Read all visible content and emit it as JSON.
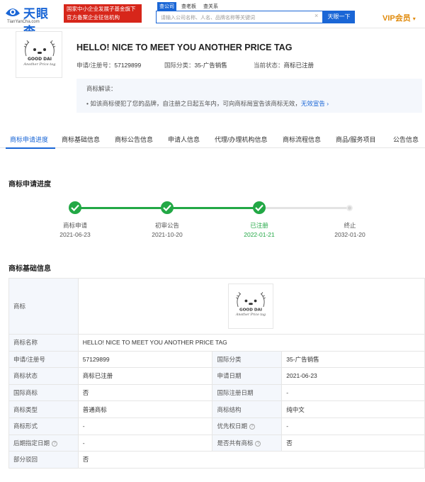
{
  "topbar": {
    "logo_text": "天眼查",
    "logo_sub": "TianYanCha.com",
    "badge_line1": "国家中小企业发展子基金旗下",
    "badge_line2": "官方备案企业征信机构",
    "search_tabs": [
      "查公司",
      "查老板",
      "查关系"
    ],
    "search_placeholder": "请输入公司名称、人名、品牌名称等关键词",
    "search_button": "天眼一下",
    "vip_label": "VIP会员",
    "brand_color": "#1a66d6"
  },
  "header": {
    "title": "HELLO! NICE TO MEET YOU ANOTHER PRICE TAG",
    "reg_no_label": "申请/注册号：",
    "reg_no": "57129899",
    "intl_class_label": "国际分类：",
    "intl_class": "35-广告销售",
    "status_label": "当前状态：",
    "status": "商标已注册",
    "thumb_text_top": "GOOD DAI",
    "thumb_text_bottom": "Another Price tag"
  },
  "notice": {
    "title": "商标解读：",
    "text": "如该商标侵犯了您的品牌，自注册之日起五年内，可向商标局宣告该商标无效",
    "link": "无效宣告"
  },
  "tabs": [
    "商标申请进度",
    "商标基础信息",
    "商标公告信息",
    "申请人信息",
    "代理/办理机构信息",
    "商标流程信息",
    "商品/服务项目",
    "公告信息"
  ],
  "progress": {
    "title": "商标申请进度",
    "steps": [
      {
        "label": "商标申请",
        "date": "2021-06-23",
        "state": "done"
      },
      {
        "label": "初审公告",
        "date": "2021-10-20",
        "state": "done"
      },
      {
        "label": "已注册",
        "date": "2022-01-21",
        "state": "current"
      },
      {
        "label": "终止",
        "date": "2032-01-20",
        "state": "pending"
      }
    ],
    "done_color": "#22a845"
  },
  "basic": {
    "title": "商标基础信息",
    "logo_label": "商标",
    "rows": [
      {
        "k1": "商标名称",
        "v1": "HELLO! NICE TO MEET YOU ANOTHER PRICE TAG"
      },
      {
        "k1": "申请/注册号",
        "v1": "57129899",
        "k2": "国际分类",
        "v2": "35-广告销售"
      },
      {
        "k1": "商标状态",
        "v1": "商标已注册",
        "k2": "申请日期",
        "v2": "2021-06-23"
      },
      {
        "k1": "国际商标",
        "v1": "否",
        "k2": "国际注册日期",
        "v2": "-"
      },
      {
        "k1": "商标类型",
        "v1": "普通商标",
        "k2": "商标结构",
        "v2": "纯中文"
      },
      {
        "k1": "商标形式",
        "v1": "-",
        "k2": "优先权日期",
        "v2": "-"
      },
      {
        "k1": "后期指定日期",
        "v1": "-",
        "k2": "是否共有商标",
        "v2": "否"
      },
      {
        "k1": "部分驳回",
        "v1": "否"
      }
    ]
  }
}
